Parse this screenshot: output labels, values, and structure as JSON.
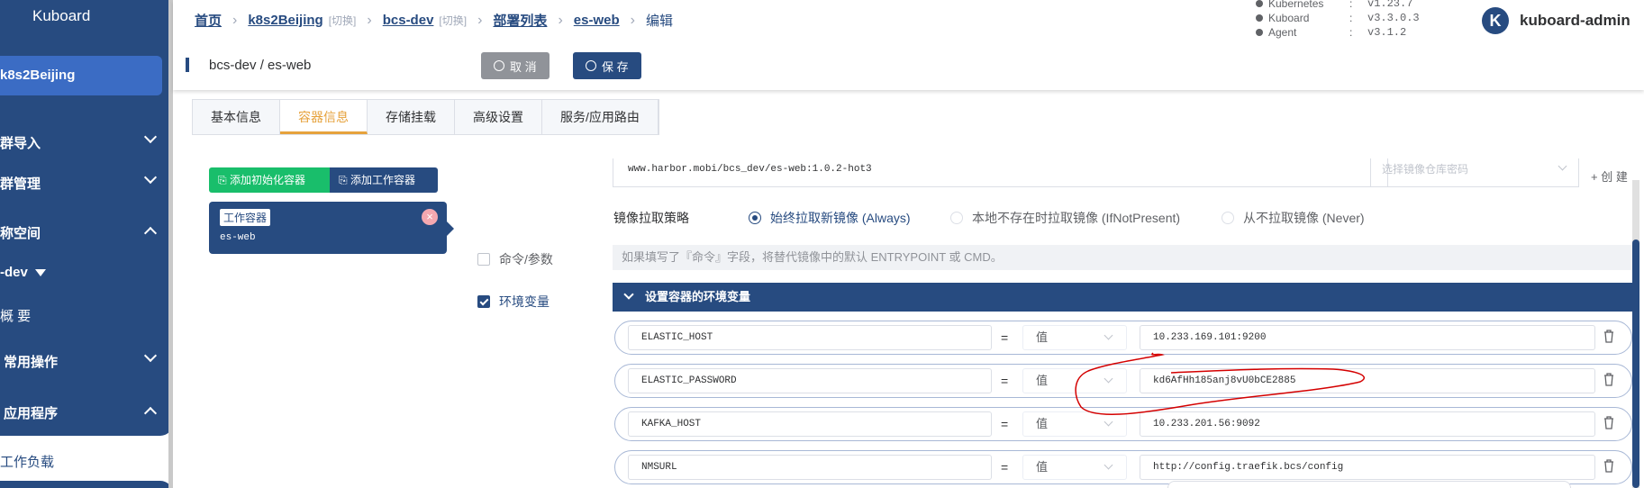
{
  "sidebar": {
    "logo": "Kuboard",
    "cluster": "k8s2Beijing",
    "items": [
      {
        "label": "群导入",
        "state": "collapsed"
      },
      {
        "label": "群管理",
        "state": "collapsed"
      },
      {
        "label": "称空间",
        "state": "expanded"
      }
    ],
    "namespace": "-dev",
    "overview": "概 要",
    "groups": [
      {
        "label": "常用操作",
        "state": "collapsed"
      },
      {
        "label": "应用程序",
        "state": "expanded"
      }
    ],
    "workload": "工作负载"
  },
  "header": {
    "breadcrumb": [
      {
        "label": "首页",
        "switch": ""
      },
      {
        "label": "k8s2Beijing",
        "switch": "[切换]"
      },
      {
        "label": "bcs-dev",
        "switch": "[切换]"
      },
      {
        "label": "部署列表",
        "switch": ""
      },
      {
        "label": "es-web",
        "switch": ""
      }
    ],
    "current": "编辑",
    "versions": [
      {
        "name": "Kubernetes",
        "value": "v1.23.7"
      },
      {
        "name": "Kuboard",
        "value": "v3.3.0.3"
      },
      {
        "name": "Agent",
        "value": "v3.1.2"
      }
    ],
    "avatar_letter": "K",
    "user": "kuboard-admin",
    "title": "bcs-dev / es-web",
    "cancel_label": "取 消",
    "save_label": "保 存"
  },
  "tabs": [
    "基本信息",
    "容器信息",
    "存储挂载",
    "高级设置",
    "服务/应用路由"
  ],
  "active_tab": "容器信息",
  "containers": {
    "add_init_label": "添加初始化容器",
    "add_work_label": "添加工作容器",
    "card_tag": "工作容器",
    "card_name": "es-web"
  },
  "form": {
    "image": "www.harbor.mobi/bcs_dev/es-web:1.0.2-hot3",
    "secret_placeholder": "选择镜像仓库密码",
    "create_label": "+ 创 建",
    "pull_policy_label": "镜像拉取策略",
    "pull_options": [
      {
        "label": "始终拉取新镜像 (Always)",
        "selected": true
      },
      {
        "label": "本地不存在时拉取镜像 (IfNotPresent)",
        "selected": false
      },
      {
        "label": "从不拉取镜像 (Never)",
        "selected": false
      }
    ],
    "cmd_label": "命令/参数",
    "cmd_checked": false,
    "cmd_hint": "如果填写了『命令』字段，将替代镜像中的默认 ENTRYPOINT 或 CMD。",
    "env_label": "环境变量",
    "env_checked": true,
    "env_header": "设置容器的环境变量",
    "env_vars": [
      {
        "name": "ELASTIC_HOST",
        "eq": "=",
        "type": "值",
        "value": "10.233.169.101:9200"
      },
      {
        "name": "ELASTIC_PASSWORD",
        "eq": "=",
        "type": "值",
        "value": "kd6AfHh185anj8vU0bCE2885"
      },
      {
        "name": "KAFKA_HOST",
        "eq": "=",
        "type": "值",
        "value": "10.233.201.56:9092"
      },
      {
        "name": "NMSURL",
        "eq": "=",
        "type": "值",
        "value": "http://config.traefik.bcs/config"
      }
    ]
  },
  "colors": {
    "primary": "#274b80",
    "accent_tab": "#e6a23c",
    "green": "#19be6b",
    "annotation": "#d40000"
  }
}
